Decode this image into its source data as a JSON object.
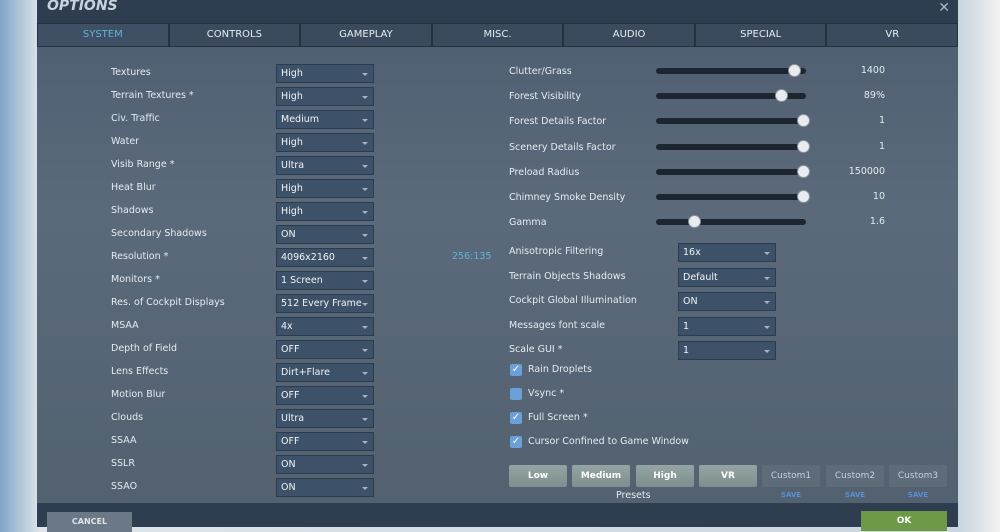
{
  "window": {
    "title": "OPTIONS",
    "close_icon": "close-icon"
  },
  "tabs": [
    "SYSTEM",
    "CONTROLS",
    "GAMEPLAY",
    "MISC.",
    "AUDIO",
    "SPECIAL",
    "VR"
  ],
  "left_settings": [
    {
      "label": "Textures",
      "value": "High"
    },
    {
      "label": "Terrain Textures *",
      "value": "High"
    },
    {
      "label": "Civ. Traffic",
      "value": "Medium"
    },
    {
      "label": "Water",
      "value": "High"
    },
    {
      "label": "Visib Range *",
      "value": "Ultra"
    },
    {
      "label": "Heat Blur",
      "value": "High"
    },
    {
      "label": "Shadows",
      "value": "High"
    },
    {
      "label": "Secondary Shadows",
      "value": "ON"
    },
    {
      "label": "Resolution *",
      "value": "4096x2160"
    },
    {
      "label": "Monitors *",
      "value": "1 Screen"
    },
    {
      "label": "Res. of Cockpit Displays",
      "value": "512 Every Frame"
    },
    {
      "label": "MSAA",
      "value": "4x"
    },
    {
      "label": "Depth of Field",
      "value": "OFF"
    },
    {
      "label": "Lens Effects",
      "value": "Dirt+Flare"
    },
    {
      "label": "Motion Blur",
      "value": "OFF"
    },
    {
      "label": "Clouds",
      "value": "Ultra"
    },
    {
      "label": "SSAA",
      "value": "OFF"
    },
    {
      "label": "SSLR",
      "value": "ON"
    },
    {
      "label": "SSAO",
      "value": "ON"
    }
  ],
  "aspect_ratio": "256:135",
  "sliders": [
    {
      "label": "Clutter/Grass",
      "value": "1400",
      "fraction": 0.92
    },
    {
      "label": "Forest Visibility",
      "value": "89%",
      "fraction": 0.83
    },
    {
      "label": "Forest Details Factor",
      "value": "1",
      "fraction": 0.98
    },
    {
      "label": "Scenery Details Factor",
      "value": "1",
      "fraction": 0.98
    },
    {
      "label": "Preload Radius",
      "value": "150000",
      "fraction": 0.98
    },
    {
      "label": "Chimney Smoke Density",
      "value": "10",
      "fraction": 0.98
    },
    {
      "label": "Gamma",
      "value": "1.6",
      "fraction": 0.25
    }
  ],
  "right_settings": [
    {
      "label": "Anisotropic Filtering",
      "value": "16x"
    },
    {
      "label": "Terrain Objects Shadows",
      "value": "Default"
    },
    {
      "label": "Cockpit Global Illumination",
      "value": "ON"
    },
    {
      "label": "Messages font scale",
      "value": "1"
    },
    {
      "label": "Scale GUI *",
      "value": "1"
    }
  ],
  "checkboxes": [
    {
      "label": "Rain Droplets",
      "checked": true
    },
    {
      "label": "Vsync *",
      "checked": false
    },
    {
      "label": "Full Screen *",
      "checked": true
    },
    {
      "label": "Cursor Confined to Game Window",
      "checked": true
    }
  ],
  "presets": {
    "label": "Presets",
    "buttons": [
      "Low",
      "Medium",
      "High",
      "VR"
    ],
    "custom": [
      "Custom1",
      "Custom2",
      "Custom3"
    ],
    "save_label": "SAVE"
  },
  "footer": {
    "cancel": "CANCEL",
    "ok": "OK"
  }
}
